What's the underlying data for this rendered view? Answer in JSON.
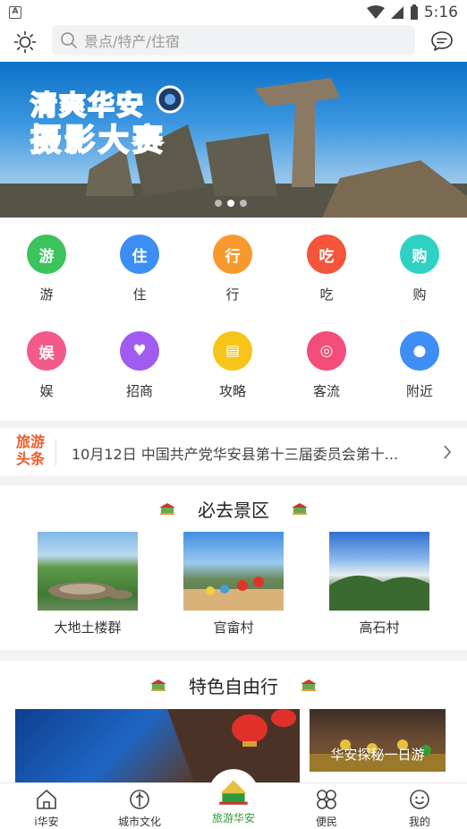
{
  "status_bar": {
    "time": "5:16",
    "app_badge": "A"
  },
  "header": {
    "search_placeholder": "景点/特产/住宿"
  },
  "banner": {
    "title_line1": "清爽华安",
    "title_line2": "摄影大赛",
    "dot_count": 3,
    "active_dot": 1
  },
  "categories": [
    {
      "label": "游",
      "glyph": "游",
      "color": "#3cc35c",
      "icon": "tour-icon"
    },
    {
      "label": "住",
      "glyph": "住",
      "color": "#3c8ef5",
      "icon": "hotel-icon"
    },
    {
      "label": "行",
      "glyph": "行",
      "color": "#f79a2e",
      "icon": "travel-icon"
    },
    {
      "label": "吃",
      "glyph": "吃",
      "color": "#f3543a",
      "icon": "food-icon"
    },
    {
      "label": "购",
      "glyph": "购",
      "color": "#2fd1c4",
      "icon": "shopping-icon"
    },
    {
      "label": "娱",
      "glyph": "娱",
      "color": "#f35a8a",
      "icon": "entertainment-icon"
    },
    {
      "label": "招商",
      "glyph": "♥",
      "color": "#a05cf0",
      "icon": "handshake-icon"
    },
    {
      "label": "攻略",
      "glyph": "▤",
      "color": "#f7c51a",
      "icon": "guide-book-icon"
    },
    {
      "label": "客流",
      "glyph": "◎",
      "color": "#f24d7a",
      "icon": "visitor-flow-icon"
    },
    {
      "label": "附近",
      "glyph": "●",
      "color": "#3f8ef5",
      "icon": "location-pin-icon"
    }
  ],
  "ticker": {
    "tag_line1": "旅游",
    "tag_line2": "头条",
    "text": "10月12日 中国共产党华安县第十三届委员会第十..."
  },
  "must_visit": {
    "title": "必去景区",
    "spots": [
      {
        "label": "大地土楼群"
      },
      {
        "label": "官畲村"
      },
      {
        "label": "高石村"
      }
    ]
  },
  "free_travel": {
    "title": "特色自由行",
    "secondary_label": "华安探秘一日游"
  },
  "bottom_nav": [
    {
      "label": "i华安",
      "icon": "home-icon",
      "active": false
    },
    {
      "label": "城市文化",
      "icon": "city-culture-icon",
      "active": false
    },
    {
      "label": "旅游华安",
      "icon": "tourism-icon",
      "active": true
    },
    {
      "label": "便民",
      "icon": "services-grid-icon",
      "active": false
    },
    {
      "label": "我的",
      "icon": "profile-smile-icon",
      "active": false
    }
  ],
  "colors": {
    "accent_green": "#2e9a3e",
    "ticker_orange": "#f05a28",
    "search_bg": "#f1f2f4"
  }
}
